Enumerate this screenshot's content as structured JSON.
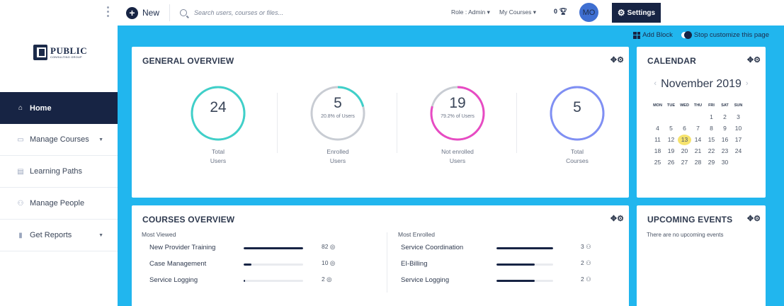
{
  "sidebar": {
    "logo": {
      "name": "PUBLIC",
      "sub": "CONSULTING GROUP"
    },
    "items": [
      {
        "label": "Home",
        "icon": "home-icon"
      },
      {
        "label": "Manage Courses",
        "icon": "courses-icon"
      },
      {
        "label": "Learning Paths",
        "icon": "paths-icon"
      },
      {
        "label": "Manage People",
        "icon": "people-icon"
      },
      {
        "label": "Get Reports",
        "icon": "reports-icon"
      }
    ]
  },
  "topbar": {
    "new_label": "New",
    "search_placeholder": "Search users, courses or files...",
    "role_label": "Role : Admin",
    "courses_label": "My Courses",
    "trophy_count": "0",
    "avatar_initials": "MO",
    "settings_label": "Settings"
  },
  "customize": {
    "add_block": "Add Block",
    "stop_customize": "Stop customize this page"
  },
  "general_overview": {
    "title": "GENERAL OVERVIEW",
    "stats": [
      {
        "value": "24",
        "sub": "",
        "label1": "Total",
        "label2": "Users",
        "color": "#3fd0c9",
        "fraction": 1.0
      },
      {
        "value": "5",
        "sub": "20.8% of Users",
        "label1": "Enrolled",
        "label2": "Users",
        "color": "#3fd0c9",
        "fraction": 0.208
      },
      {
        "value": "19",
        "sub": "79.2% of Users",
        "label1": "Not enrolled",
        "label2": "Users",
        "color": "#e84ac3",
        "fraction": 0.792
      },
      {
        "value": "5",
        "sub": "",
        "label1": "Total",
        "label2": "Courses",
        "color": "#7f8ff4",
        "fraction": 1.0
      }
    ]
  },
  "calendar": {
    "title": "CALENDAR",
    "month": "November 2019",
    "days": [
      "MON",
      "TUE",
      "WED",
      "THU",
      "FRI",
      "SAT",
      "SUN"
    ],
    "weeks": [
      [
        "",
        "",
        "",
        "",
        "1",
        "2",
        "3"
      ],
      [
        "4",
        "5",
        "6",
        "7",
        "8",
        "9",
        "10"
      ],
      [
        "11",
        "12",
        "13",
        "14",
        "15",
        "16",
        "17"
      ],
      [
        "18",
        "19",
        "20",
        "21",
        "22",
        "23",
        "24"
      ],
      [
        "25",
        "26",
        "27",
        "28",
        "29",
        "30",
        ""
      ]
    ],
    "today": "13"
  },
  "courses_overview": {
    "title": "COURSES OVERVIEW",
    "most_viewed_label": "Most Viewed",
    "most_enrolled_label": "Most Enrolled",
    "most_viewed": [
      {
        "name": "New Provider Training",
        "count": "82",
        "fraction": 1.0
      },
      {
        "name": "Case Management",
        "count": "10",
        "fraction": 0.13
      },
      {
        "name": "Service Logging",
        "count": "2",
        "fraction": 0.025
      }
    ],
    "most_enrolled": [
      {
        "name": "Service Coordination",
        "count": "3",
        "fraction": 1.0
      },
      {
        "name": "EI-Billing",
        "count": "2",
        "fraction": 0.67
      },
      {
        "name": "Service Logging",
        "count": "2",
        "fraction": 0.67
      }
    ]
  },
  "upcoming_events": {
    "title": "UPCOMING EVENTS",
    "empty_text": "There are no upcoming events"
  }
}
